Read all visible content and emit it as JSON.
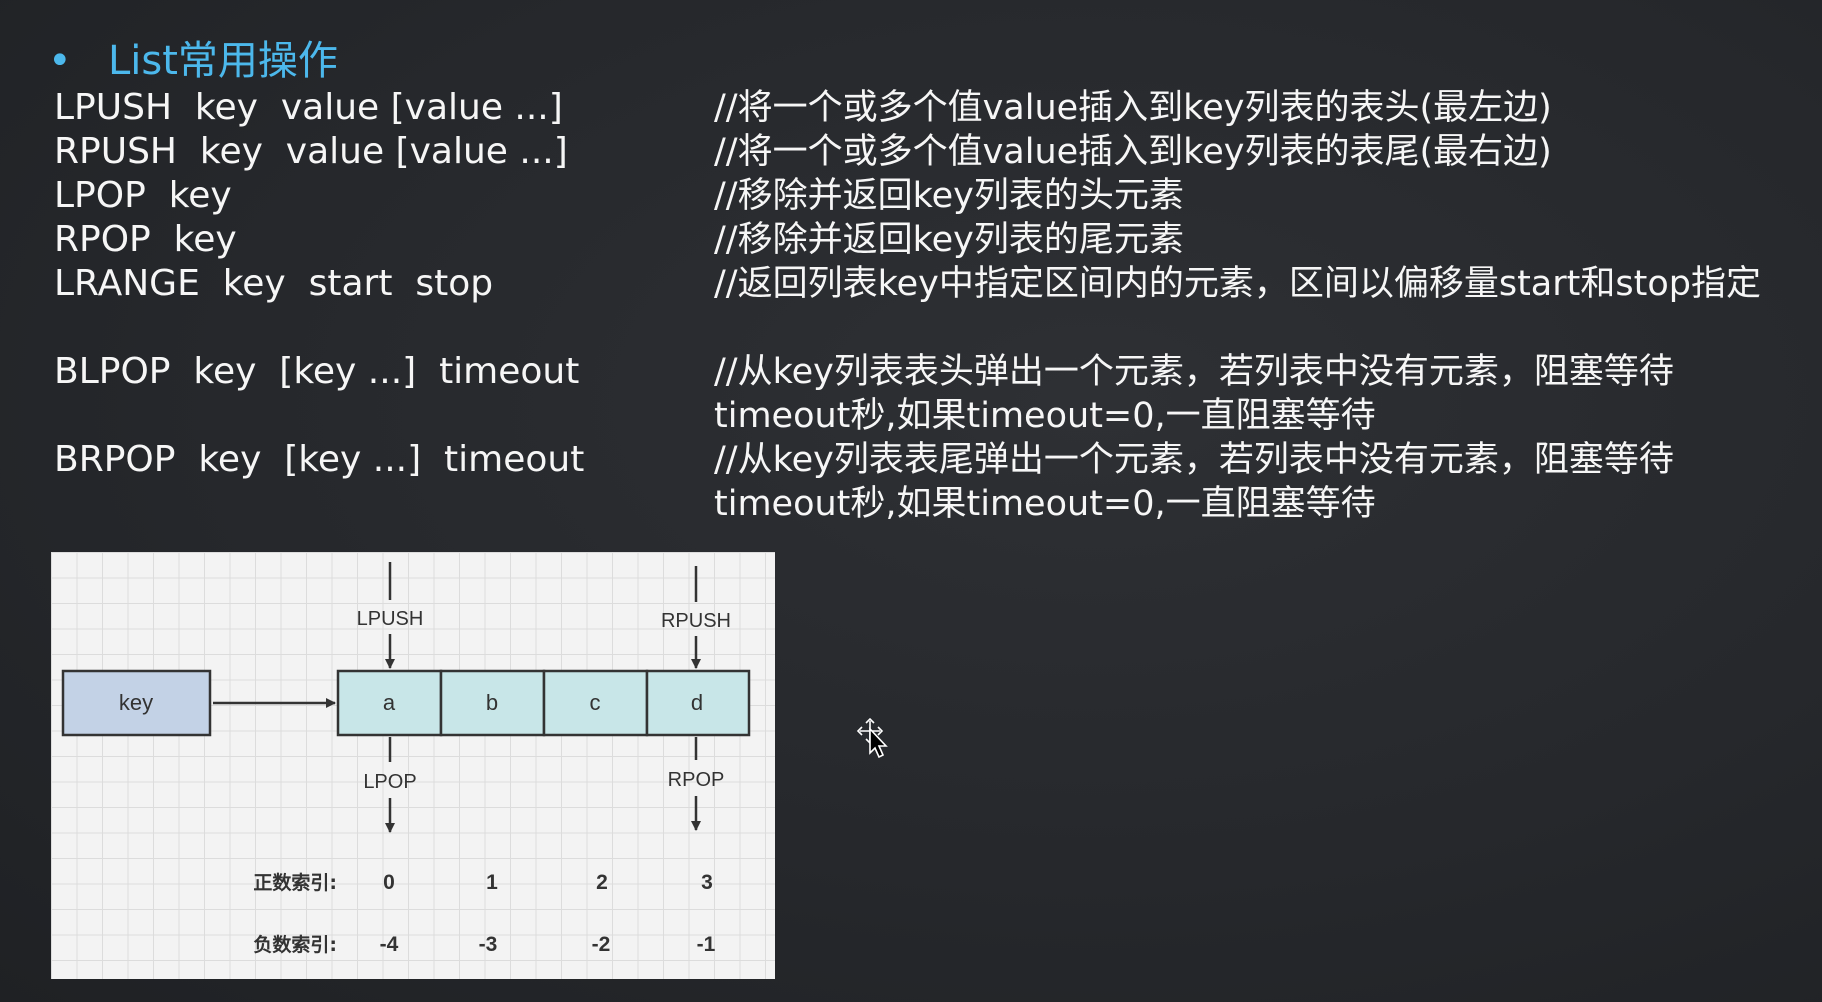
{
  "heading": {
    "bullet": "•",
    "title": "List常用操作"
  },
  "commands": [
    {
      "syntax": "LPUSH  key  value [value ...]",
      "description": [
        "//将一个或多个值value插入到key列表的表头(最左边)"
      ]
    },
    {
      "syntax": "RPUSH  key  value [value ...]",
      "description": [
        "//将一个或多个值value插入到key列表的表尾(最右边)"
      ]
    },
    {
      "syntax": "LPOP  key",
      "description": [
        "//移除并返回key列表的头元素"
      ]
    },
    {
      "syntax": "RPOP  key",
      "description": [
        "//移除并返回key列表的尾元素"
      ]
    },
    {
      "syntax": "LRANGE  key  start  stop",
      "description": [
        "//返回列表key中指定区间内的元素，区间以偏移量start和stop指定"
      ]
    },
    {
      "syntax": "BLPOP  key  [key ...]  timeout",
      "description": [
        "//从key列表表头弹出一个元素，若列表中没有元素，阻塞等待",
        "timeout秒,如果timeout=0,一直阻塞等待"
      ]
    },
    {
      "syntax": "BRPOP  key  [key ...]  timeout",
      "description": [
        "//从key列表表尾弹出一个元素，若列表中没有元素，阻塞等待",
        "timeout秒,如果timeout=0,一直阻塞等待"
      ]
    }
  ],
  "diagram": {
    "key_label": "key",
    "cells": [
      "a",
      "b",
      "c",
      "d"
    ],
    "lpush_label": "LPUSH",
    "rpush_label": "RPUSH",
    "lpop_label": "LPOP",
    "rpop_label": "RPOP",
    "positive_index_label": "正数索引:",
    "positive_indices": [
      "0",
      "1",
      "2",
      "3"
    ],
    "negative_index_label": "负数索引:",
    "negative_indices": [
      "-4",
      "-3",
      "-2",
      "-1"
    ],
    "colors": {
      "key_fill": "#c3d2e6",
      "cell_fill": "#c8e6e8",
      "stroke": "#333333"
    }
  }
}
